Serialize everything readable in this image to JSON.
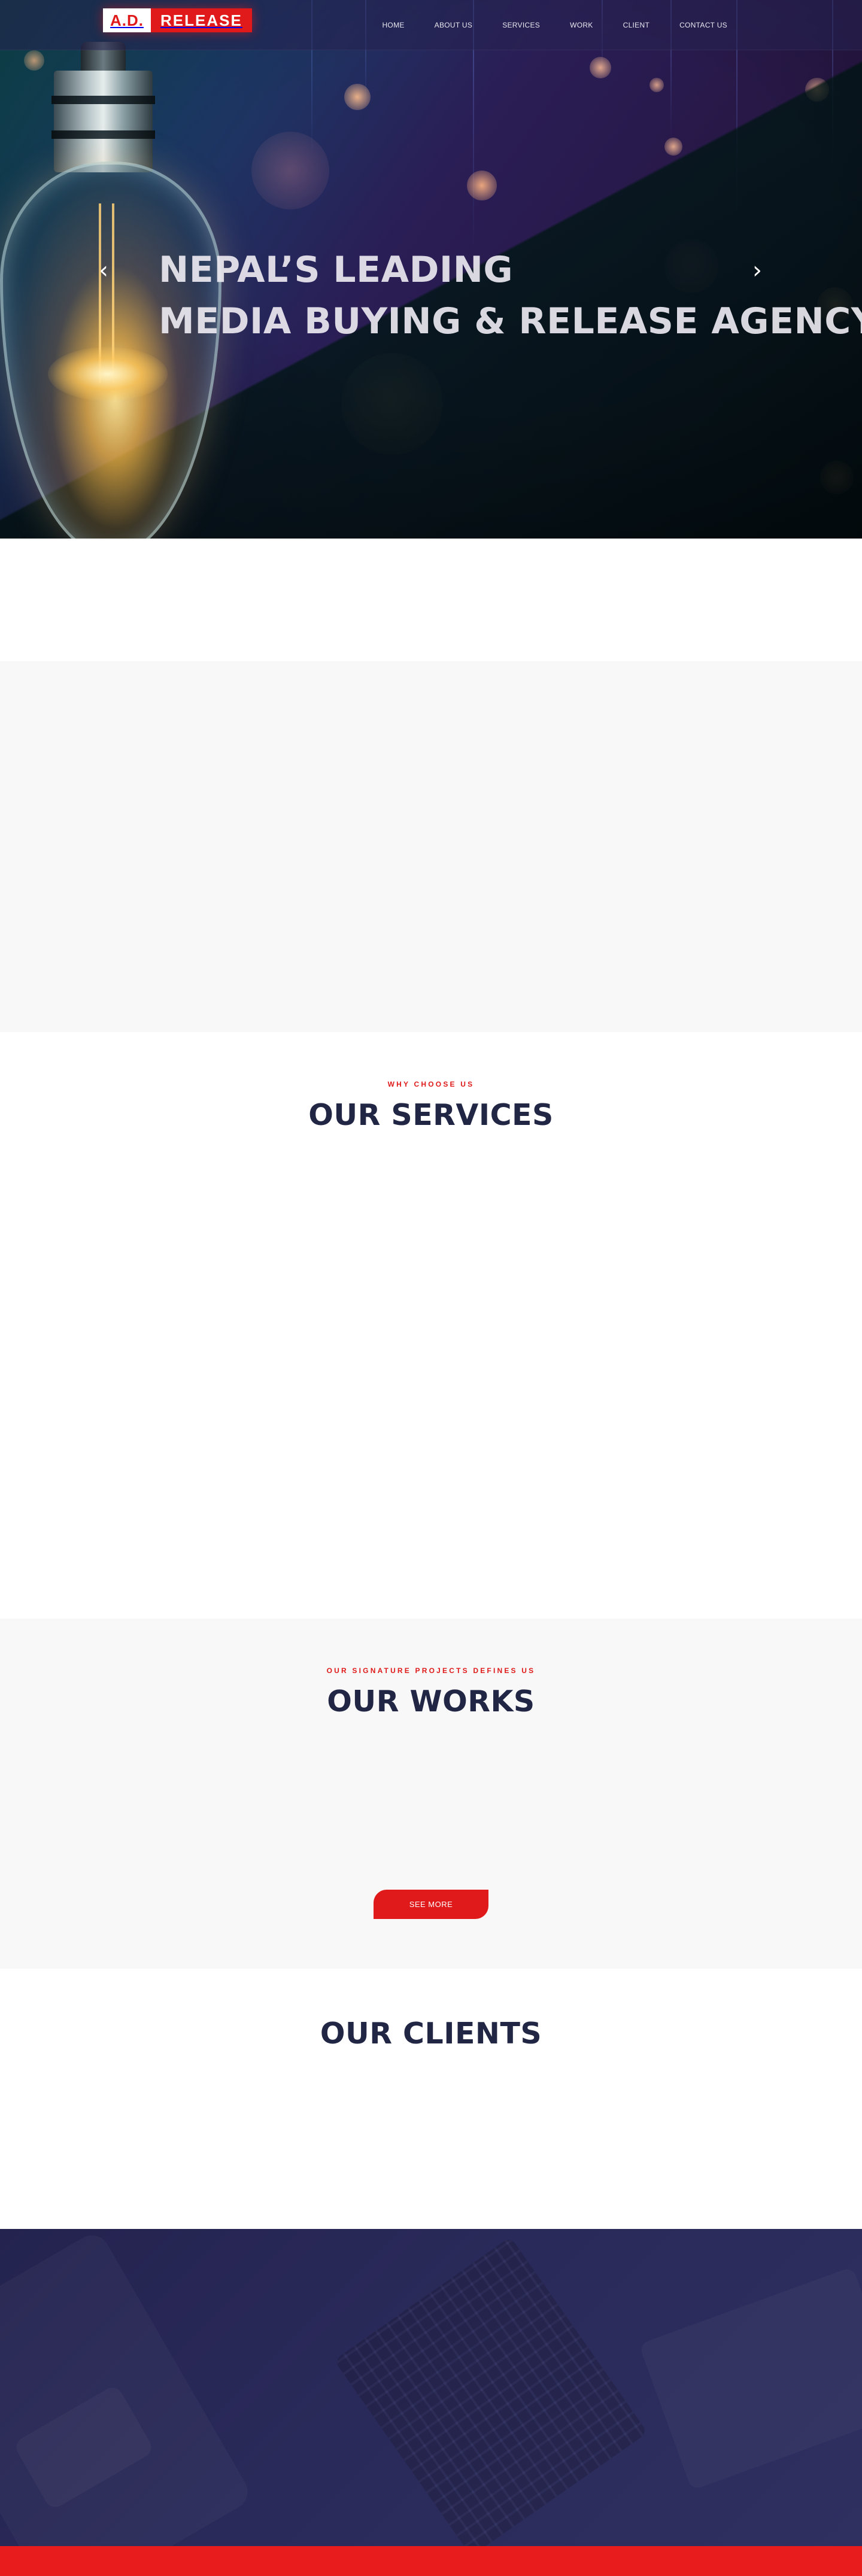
{
  "header": {
    "logo_ad": "A.D.",
    "logo_release": "RELEASE",
    "nav": [
      "HOME",
      "ABOUT US",
      "SERVICES",
      "WORK",
      "CLIENT",
      "CONTACT US"
    ]
  },
  "hero": {
    "title_line1": "NEPAL’S LEADING",
    "title_line2": "MEDIA BUYING & RELEASE AGENCY",
    "prev_icon": "chevron-left-icon",
    "next_icon": "chevron-right-icon",
    "prev_glyph": "‹",
    "next_glyph": "›"
  },
  "services": {
    "eyebrow": "WHY CHOOSE US",
    "title": "OUR SERVICES"
  },
  "works": {
    "eyebrow": "OUR SIGNATURE PROJECTS DEFINES US",
    "title": "OUR WORKS",
    "button": "SEE MORE"
  },
  "clients": {
    "title": "OUR CLIENTS"
  },
  "colors": {
    "accent_red": "#e01a1a",
    "navy": "#222645",
    "footer_navy": "#2a2a5a",
    "light_gray": "#f8f8f8"
  }
}
